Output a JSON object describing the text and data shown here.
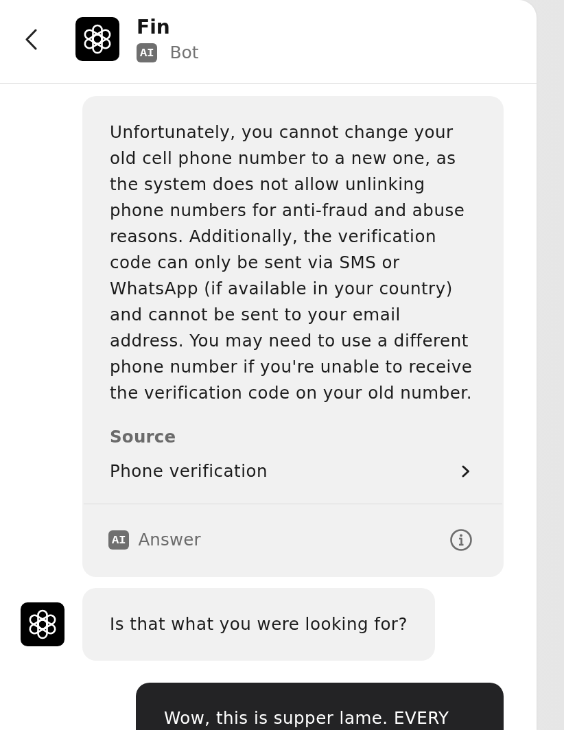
{
  "header": {
    "title": "Fin",
    "badge": "AI",
    "subtitle": "Bot"
  },
  "messages": [
    {
      "kind": "bot",
      "avatar": false,
      "text": "Unfortunately, you cannot change your old cell phone number to a new one, as the system does not allow unlinking phone numbers for anti-fraud and abuse reasons. Additionally, the verification code can only be sent via SMS or WhatsApp (if available in your country) and cannot be sent to your email address. You may need to use a different phone number if you're unable to receive the verification code on your old number.",
      "source": {
        "heading": "Source",
        "link": "Phone verification"
      },
      "footer": {
        "badge": "AI",
        "label": "Answer"
      }
    },
    {
      "kind": "bot",
      "avatar": true,
      "text": "Is that what you were looking for?"
    },
    {
      "kind": "user",
      "text": "Wow, this is supper lame. EVERY"
    }
  ]
}
